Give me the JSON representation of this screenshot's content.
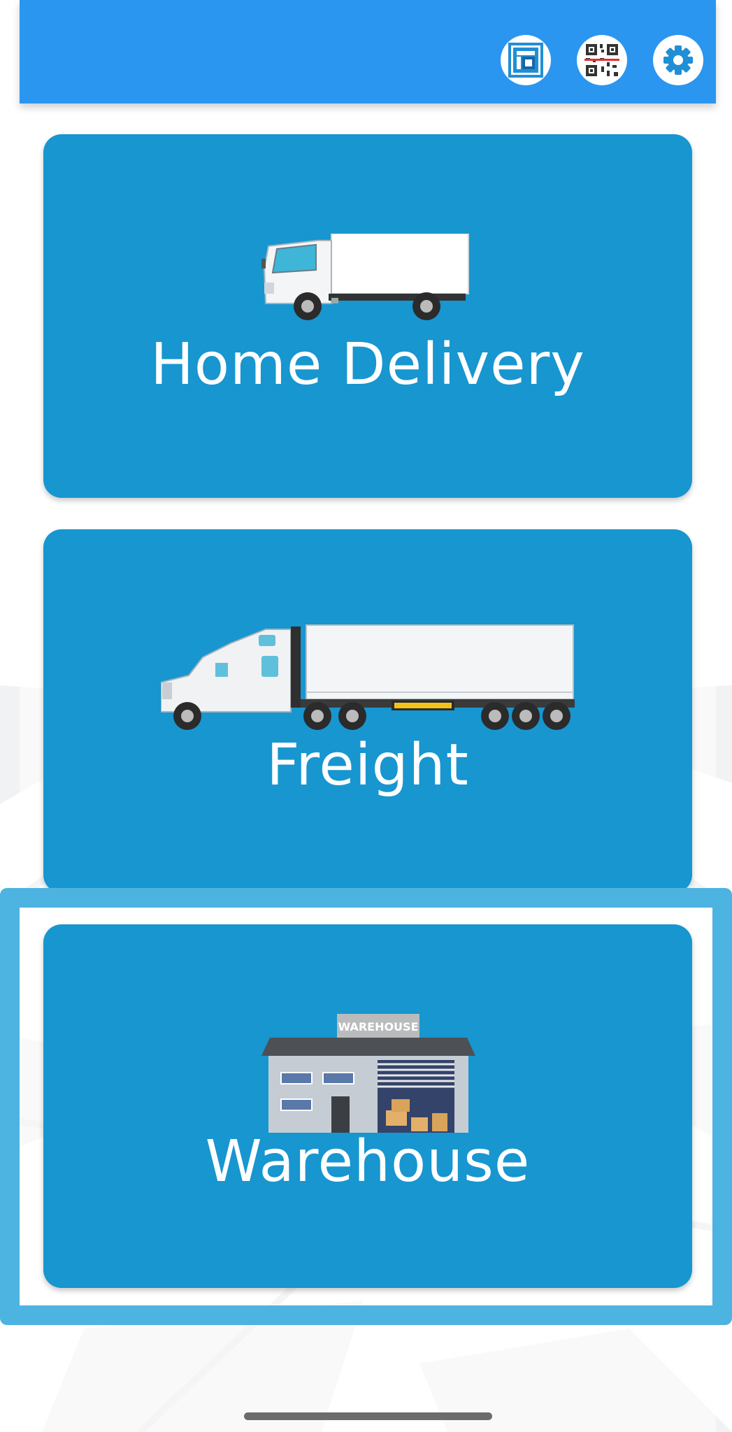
{
  "header": {
    "buttons": [
      {
        "icon": "layout-icon"
      },
      {
        "icon": "qr-code-icon"
      },
      {
        "icon": "gear-icon"
      }
    ],
    "color": "#2b96ef"
  },
  "cards": [
    {
      "label": "Home Delivery",
      "icon": "box-truck-icon"
    },
    {
      "label": "Freight",
      "icon": "semi-truck-icon"
    },
    {
      "label": "Warehouse",
      "icon": "warehouse-icon",
      "sign_text": "WAREHOUSE"
    }
  ],
  "card_color": "#1796d0",
  "highlight_color": "#4db3e0"
}
